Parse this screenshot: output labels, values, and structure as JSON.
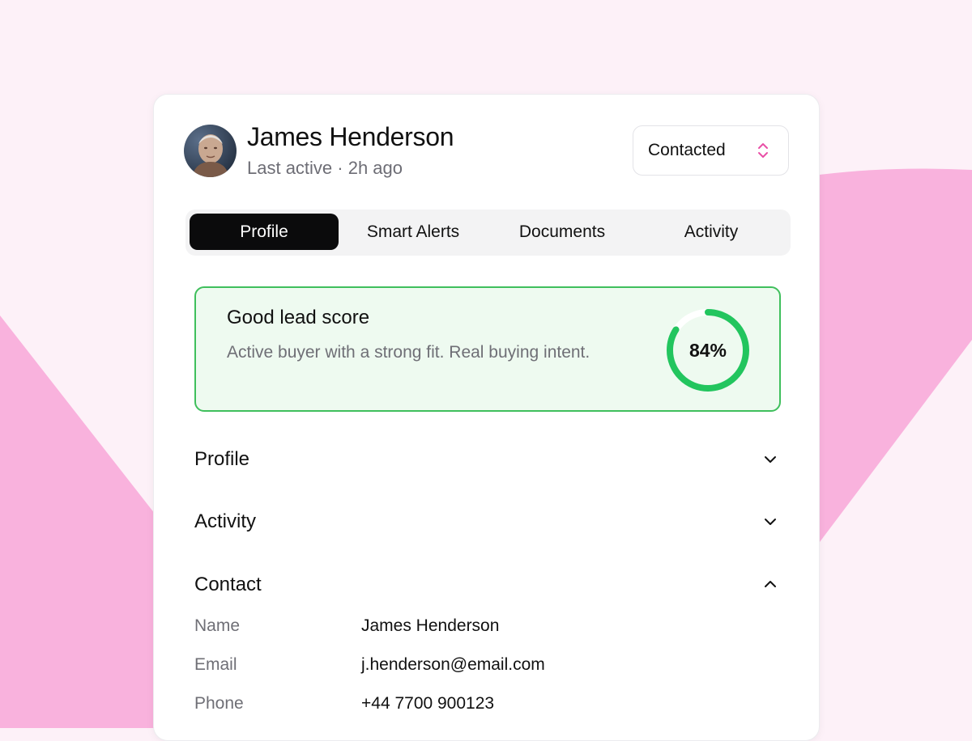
{
  "colors": {
    "background": "#fdf1f8",
    "pink_shape": "#f9b2dd",
    "accent_pink": "#e94fa7",
    "score_green": "#22c55e",
    "score_bg": "#eefaf0",
    "tab_active_bg": "#0b0b0c"
  },
  "lead": {
    "name": "James Henderson",
    "last_active": "Last active · 2h ago",
    "avatar_icon": "user-photo"
  },
  "status": {
    "selected": "Contacted",
    "icon": "chevron-up-down-icon"
  },
  "tabs": [
    {
      "label": "Profile",
      "active": true
    },
    {
      "label": "Smart Alerts",
      "active": false
    },
    {
      "label": "Documents",
      "active": false
    },
    {
      "label": "Activity",
      "active": false
    }
  ],
  "score": {
    "title": "Good lead score",
    "description": "Active buyer with a strong fit. Real buying intent.",
    "value": 84,
    "value_label": "84%"
  },
  "sections": [
    {
      "title": "Profile",
      "expanded": false,
      "icon": "chevron-down-icon"
    },
    {
      "title": "Activity",
      "expanded": false,
      "icon": "chevron-down-icon"
    },
    {
      "title": "Contact",
      "expanded": true,
      "icon": "chevron-up-icon"
    }
  ],
  "contact": {
    "fields": [
      {
        "label": "Name",
        "value": "James Henderson"
      },
      {
        "label": "Email",
        "value": "j.henderson@email.com"
      },
      {
        "label": "Phone",
        "value": "+44 7700 900123"
      }
    ]
  }
}
